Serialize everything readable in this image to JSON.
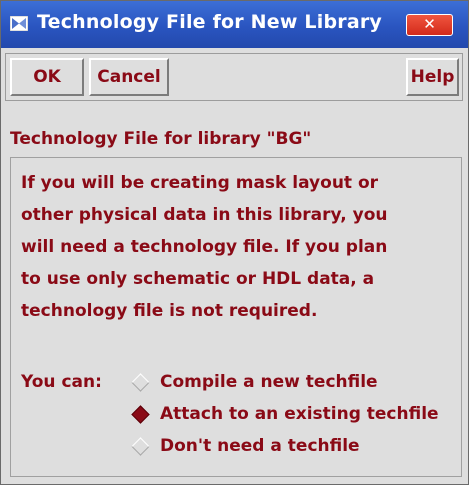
{
  "window": {
    "title": "Technology File for New Library",
    "close_glyph": "✕"
  },
  "toolbar": {
    "ok_label": "OK",
    "cancel_label": "Cancel",
    "help_label": "Help"
  },
  "section": {
    "label": "Technology File for library \"BG\""
  },
  "description": [
    "If you will be creating mask layout or",
    "other physical data in this library, you",
    "will need a technology file. If you plan",
    "to use only schematic or HDL data, a",
    "technology file is not required."
  ],
  "options": {
    "label": "You can:",
    "items": [
      {
        "label": "Compile a new techfile",
        "selected": false
      },
      {
        "label": "Attach to an existing techfile",
        "selected": true
      },
      {
        "label": "Don't need a techfile",
        "selected": false
      }
    ]
  },
  "colors": {
    "text": "#8a0a16",
    "titlebar": "#2a55c0",
    "close": "#d32b1b",
    "background": "#dedede"
  }
}
